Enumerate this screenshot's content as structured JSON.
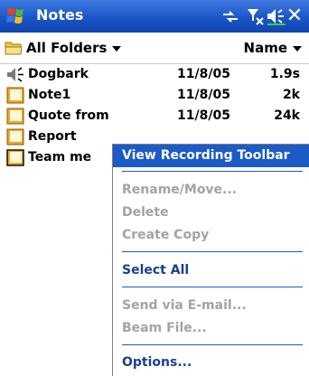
{
  "titlebar": {
    "title": "Notes",
    "icons": [
      "connectivity-icon",
      "signal-icon",
      "volume-icon",
      "close-icon"
    ],
    "close_glyph": "✕"
  },
  "header": {
    "folder_label": "All Folders",
    "sort_label": "Name"
  },
  "files": [
    {
      "icon": "speaker-icon",
      "name": "Dogbark",
      "date": "11/8/05",
      "size": "1.9s"
    },
    {
      "icon": "note-icon",
      "name": "Note1",
      "date": "11/8/05",
      "size": "2k"
    },
    {
      "icon": "note-icon",
      "name": "Quote from",
      "date": "11/8/05",
      "size": "24k"
    },
    {
      "icon": "note-icon",
      "name": "Report",
      "date": "",
      "size": ""
    },
    {
      "icon": "note-icon",
      "name": "Team me",
      "date": "",
      "size": ""
    }
  ],
  "context_menu": {
    "items": [
      {
        "label": "View Recording Toolbar",
        "state": "highlighted"
      },
      {
        "label": "Rename/Move...",
        "state": "disabled"
      },
      {
        "label": "Delete",
        "state": "disabled"
      },
      {
        "label": "Create Copy",
        "state": "disabled"
      },
      {
        "label": "Select All",
        "state": "enabled"
      },
      {
        "label": "Send via E-mail...",
        "state": "disabled"
      },
      {
        "label": "Beam File...",
        "state": "disabled"
      },
      {
        "label": "Options...",
        "state": "enabled"
      }
    ]
  },
  "colors": {
    "titlebar": "#1a56c8",
    "highlight": "#1c5ac6",
    "disabled_text": "#a3a3a3",
    "enabled_text": "#1a3f8f"
  }
}
